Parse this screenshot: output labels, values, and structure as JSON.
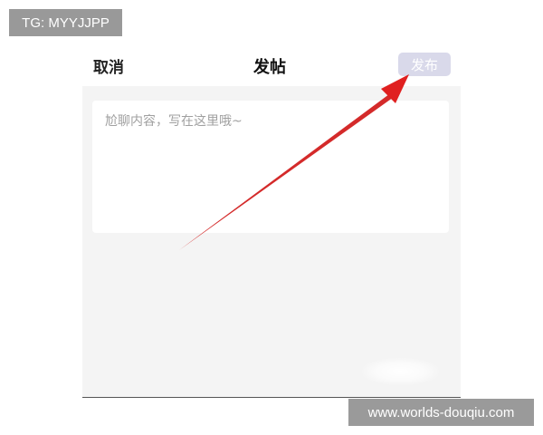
{
  "watermarks": {
    "tg": "TG: MYYJJPP",
    "site": "www.worlds-douqiu.com"
  },
  "header": {
    "cancel_label": "取消",
    "title": "发帖",
    "publish_label": "发布"
  },
  "editor": {
    "placeholder": "尬聊内容，写在这里哦~"
  },
  "colors": {
    "publish_disabled_bg": "#d9d9ea",
    "arrow": "#e02020",
    "content_bg": "#f4f4f4"
  }
}
